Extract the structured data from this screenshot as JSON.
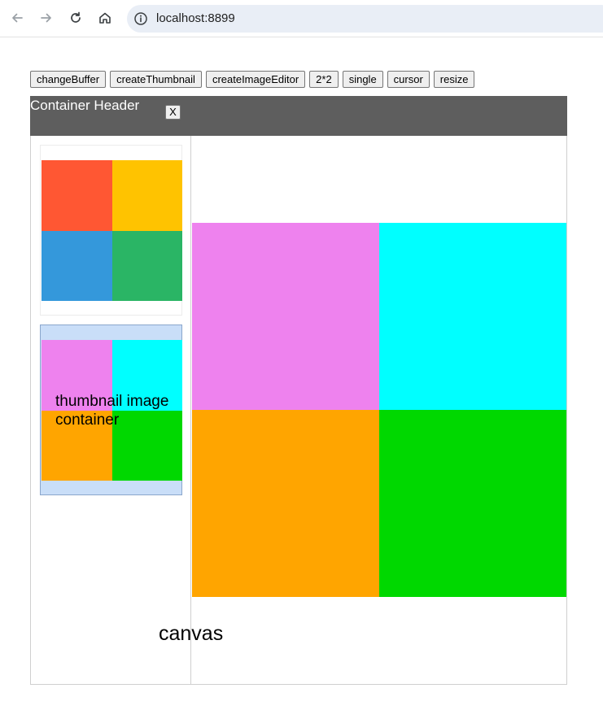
{
  "browser": {
    "url": "localhost:8899"
  },
  "toolbar": {
    "buttons": [
      "changeBuffer",
      "createThumbnail",
      "createImageEditor",
      "2*2",
      "single",
      "cursor",
      "resize"
    ]
  },
  "container": {
    "header_title": "Container Header",
    "close_label": "X"
  },
  "thumbnails": [
    {
      "colors": [
        "#ff5733",
        "#ffc300",
        "#3498db",
        "#2ab565"
      ]
    },
    {
      "colors": [
        "#ee82ee",
        "#00ffff",
        "#ffa500",
        "#00d800"
      ],
      "label": "thumbnail image container"
    }
  ],
  "canvas": {
    "label": "canvas",
    "colors": [
      "#ee82ee",
      "#00ffff",
      "#ffa500",
      "#00d800"
    ]
  },
  "colors": {
    "header_bg": "#5e5e5e",
    "selected_thumb_bg": "#c9def8"
  }
}
